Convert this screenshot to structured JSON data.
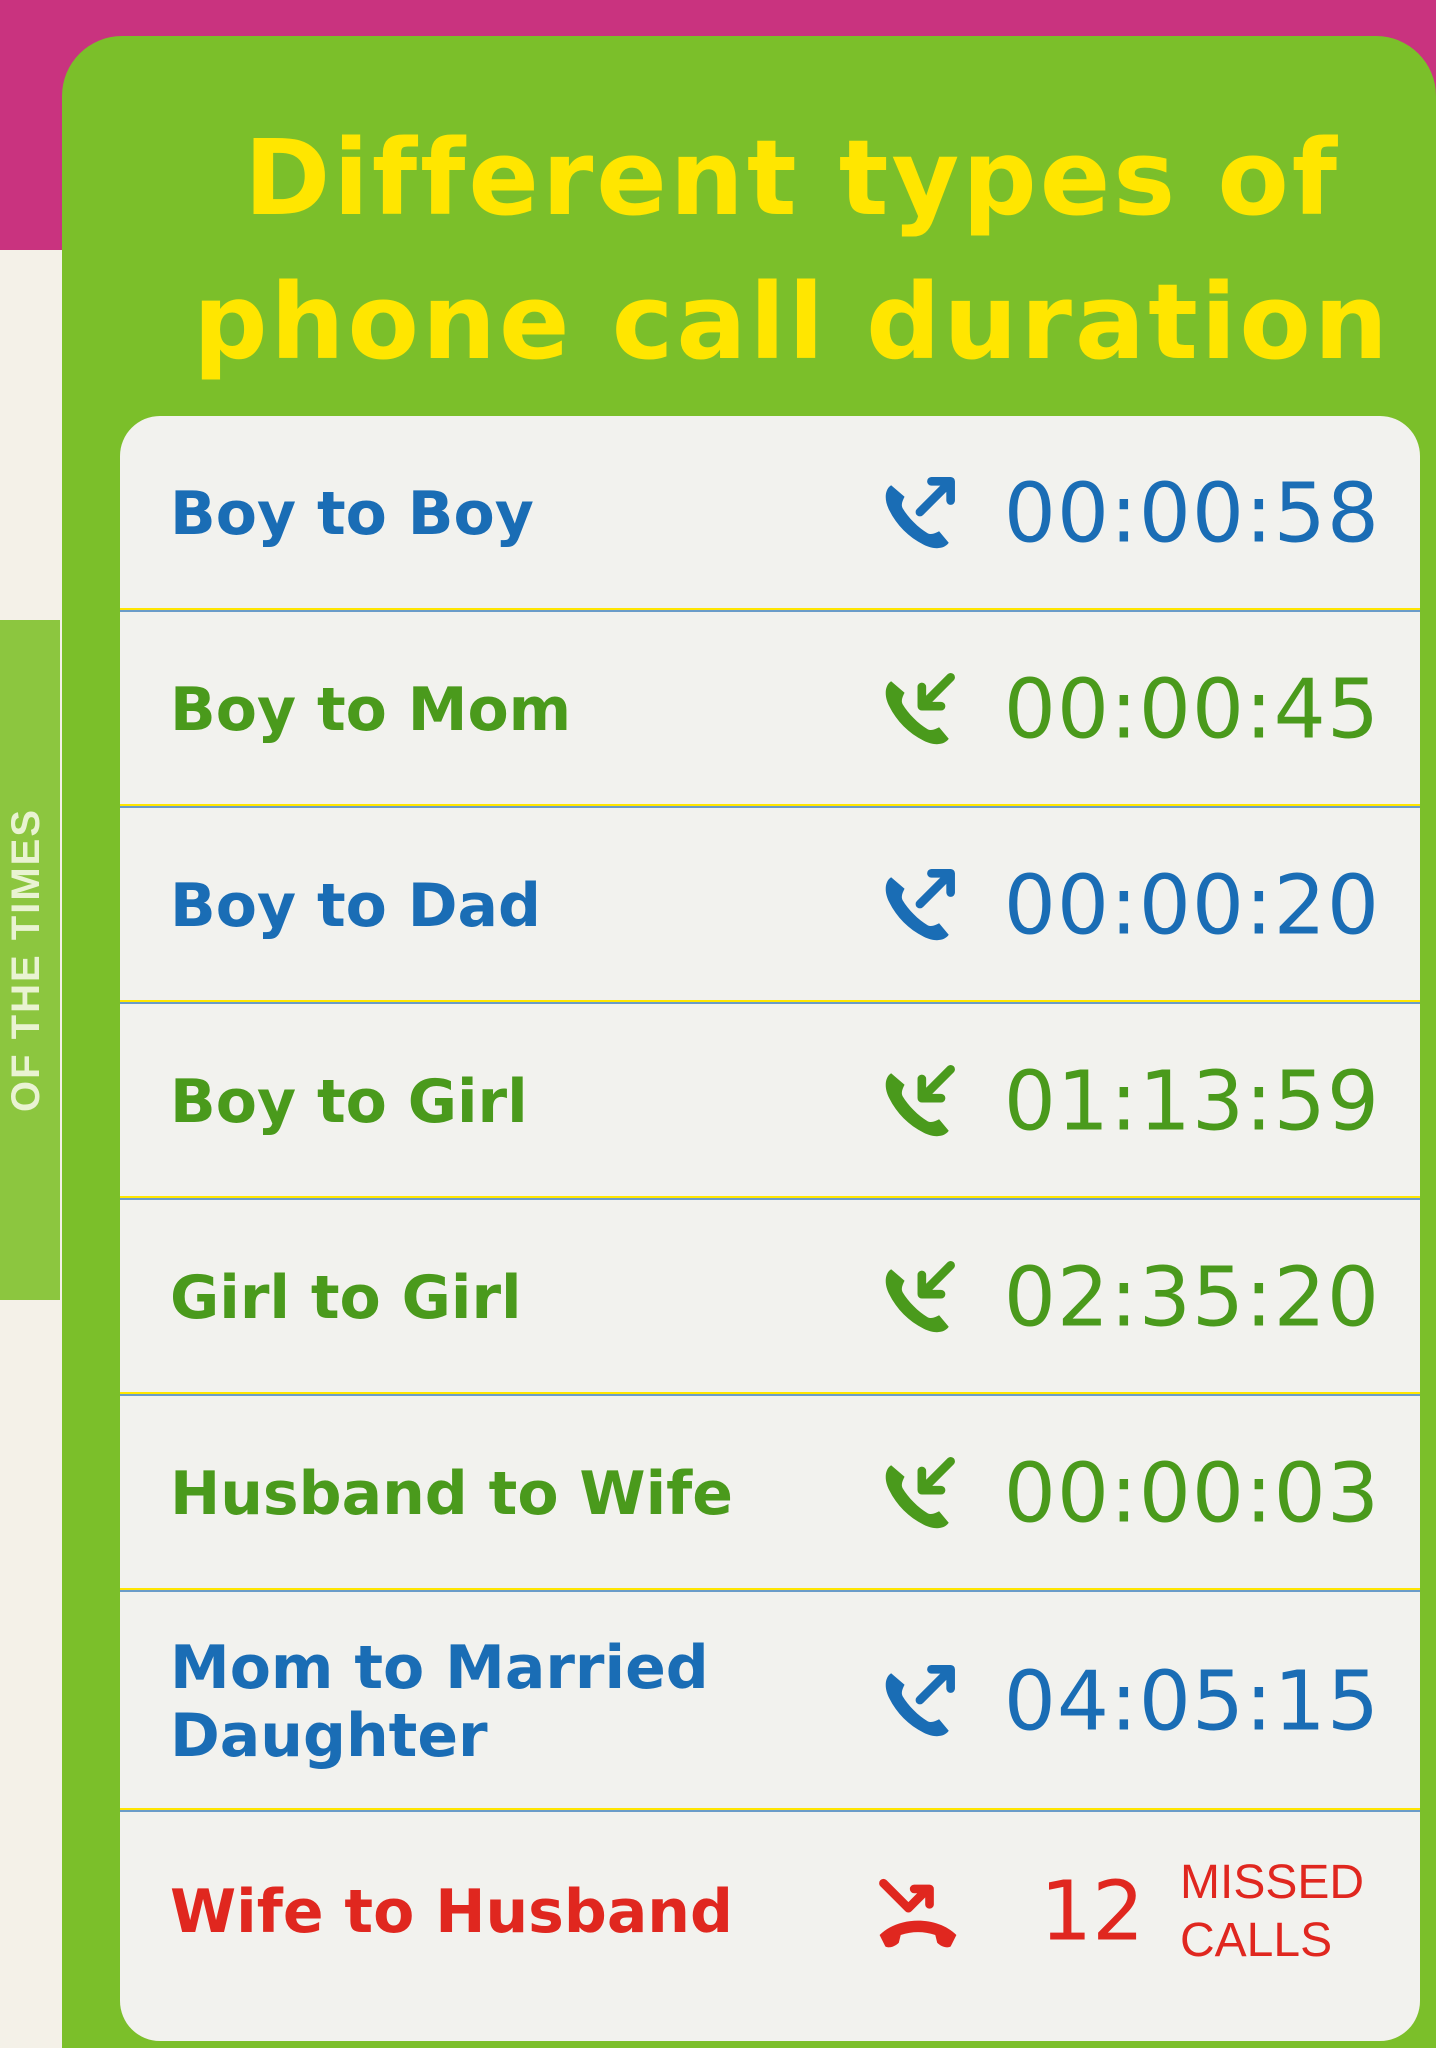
{
  "spine_text": "OF THE TIMES",
  "title": "Different types of phone call duration",
  "colors": {
    "panel": "#7bbf2a",
    "title": "#ffe600",
    "outgoing": "#1a6db5",
    "incoming": "#4a9a1c",
    "missed": "#e0271f"
  },
  "calls": [
    {
      "label": "Boy to Boy",
      "icon": "outgoing-call-icon",
      "duration": "00:00:58"
    },
    {
      "label": "Boy to Mom",
      "icon": "incoming-call-icon",
      "duration": "00:00:45"
    },
    {
      "label": "Boy to Dad",
      "icon": "outgoing-call-icon",
      "duration": "00:00:20"
    },
    {
      "label": "Boy to Girl",
      "icon": "incoming-call-icon",
      "duration": "01:13:59"
    },
    {
      "label": "Girl to Girl",
      "icon": "incoming-call-icon",
      "duration": "02:35:20"
    },
    {
      "label": "Husband to Wife",
      "icon": "incoming-call-icon",
      "duration": "00:00:03"
    },
    {
      "label": "Mom to Married Daughter",
      "icon": "outgoing-call-icon",
      "duration": "04:05:15"
    },
    {
      "label": "Wife to Husband",
      "icon": "missed-call-icon",
      "missed_count": "12",
      "missed_label_line1": "MISSED",
      "missed_label_line2": "CALLS"
    }
  ]
}
